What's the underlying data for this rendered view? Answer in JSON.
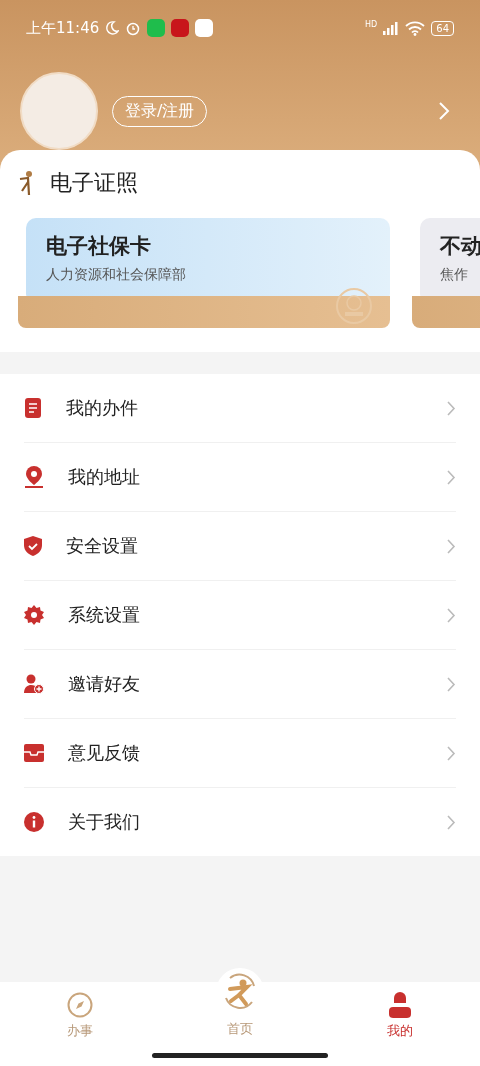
{
  "status_bar": {
    "time": "上午11:46",
    "network": "HD",
    "battery": "64"
  },
  "profile": {
    "login_button": "登录/注册"
  },
  "licenses": {
    "title": "电子证照",
    "cards": [
      {
        "kind": "social",
        "title": "电子社保卡",
        "issuer": "人力资源和社会保障部"
      },
      {
        "kind": "property",
        "title": "不动",
        "issuer": "焦作"
      }
    ]
  },
  "menu": [
    {
      "kind": "document",
      "label": "我的办件"
    },
    {
      "kind": "location",
      "label": "我的地址"
    },
    {
      "kind": "shield",
      "label": "安全设置"
    },
    {
      "kind": "gear",
      "label": "系统设置"
    },
    {
      "kind": "invite",
      "label": "邀请好友"
    },
    {
      "kind": "feedback",
      "label": "意见反馈"
    },
    {
      "kind": "info",
      "label": "关于我们"
    }
  ],
  "tab_bar": [
    {
      "kind": "compass",
      "label": "办事",
      "selected": false
    },
    {
      "kind": "home",
      "label": "首页",
      "selected": false
    },
    {
      "kind": "person",
      "label": "我的",
      "selected": true
    }
  ]
}
